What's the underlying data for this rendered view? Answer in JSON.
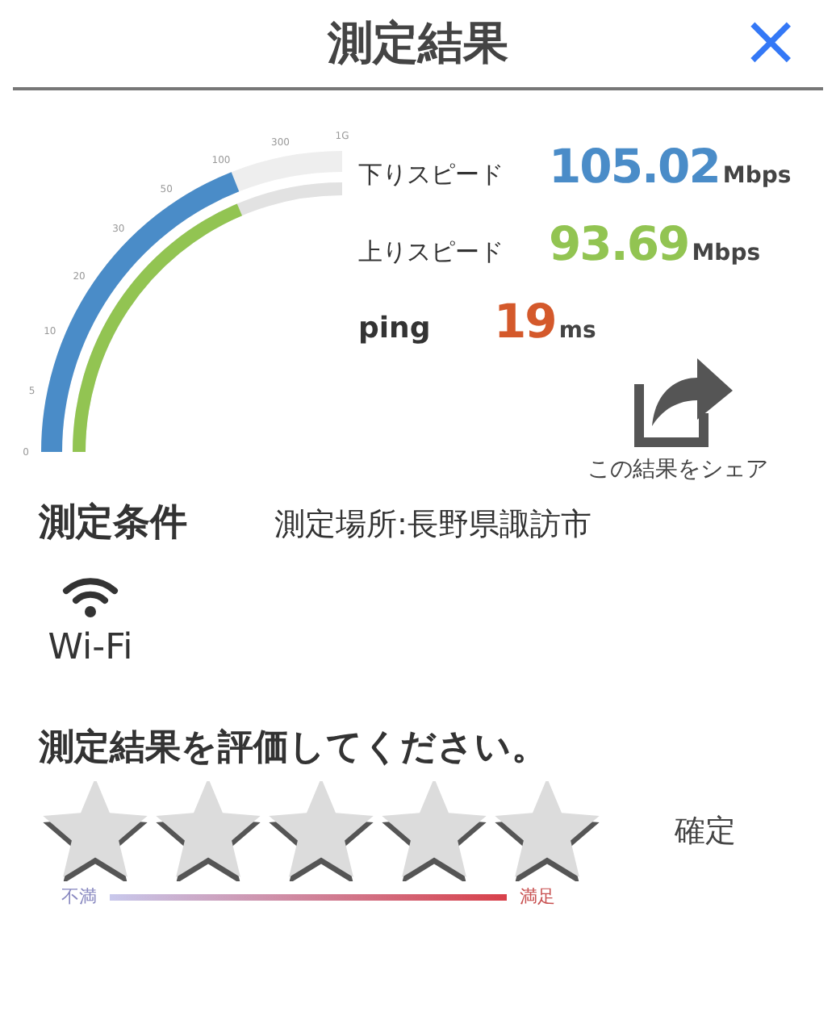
{
  "header": {
    "title": "測定結果",
    "close": "×"
  },
  "gauge": {
    "ticks": [
      "0",
      "5",
      "10",
      "20",
      "30",
      "50",
      "100",
      "300",
      "1G"
    ]
  },
  "results": [
    {
      "kind": "speed",
      "label": "下りスピード",
      "value": "105.02",
      "unit": "Mbps",
      "color": "#4a8cc8"
    },
    {
      "kind": "speed",
      "label": "上りスピード",
      "value": "93.69",
      "unit": "Mbps",
      "color": "#92c452"
    },
    {
      "kind": "ping",
      "label": "ping",
      "value": "19",
      "unit": "ms",
      "color": "#d4592b"
    }
  ],
  "share": {
    "label": "この結果をシェア"
  },
  "conditions": {
    "heading": "測定条件",
    "location": "測定場所:長野県諏訪市",
    "network": "Wi-Fi"
  },
  "rating": {
    "prompt": "測定結果を評価してください。",
    "stars": 0,
    "confirm": "確定",
    "low_label": "不満",
    "high_label": "満足"
  }
}
